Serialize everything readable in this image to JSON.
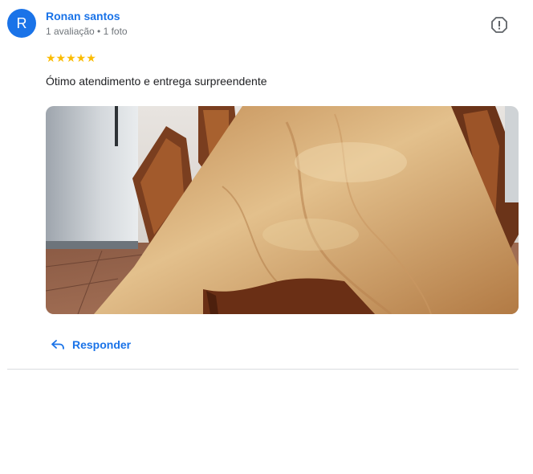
{
  "review": {
    "avatar_letter": "R",
    "author_name": "Ronan santos",
    "author_meta": "1 avaliação • 1 foto",
    "rating": 5,
    "stars_text": "★★★★★",
    "text": "Ótimo atendimento e entrega surpreendente",
    "photo_icon": "wooden-dining-table-photo",
    "report_icon": "report-icon"
  },
  "actions": {
    "reply_label": "Responder",
    "reply_icon": "reply-arrow-icon"
  },
  "colors": {
    "accent": "#1a73e8",
    "star": "#fbbc04",
    "meta": "#70757a",
    "text": "#202124",
    "divider": "#dadce0"
  }
}
